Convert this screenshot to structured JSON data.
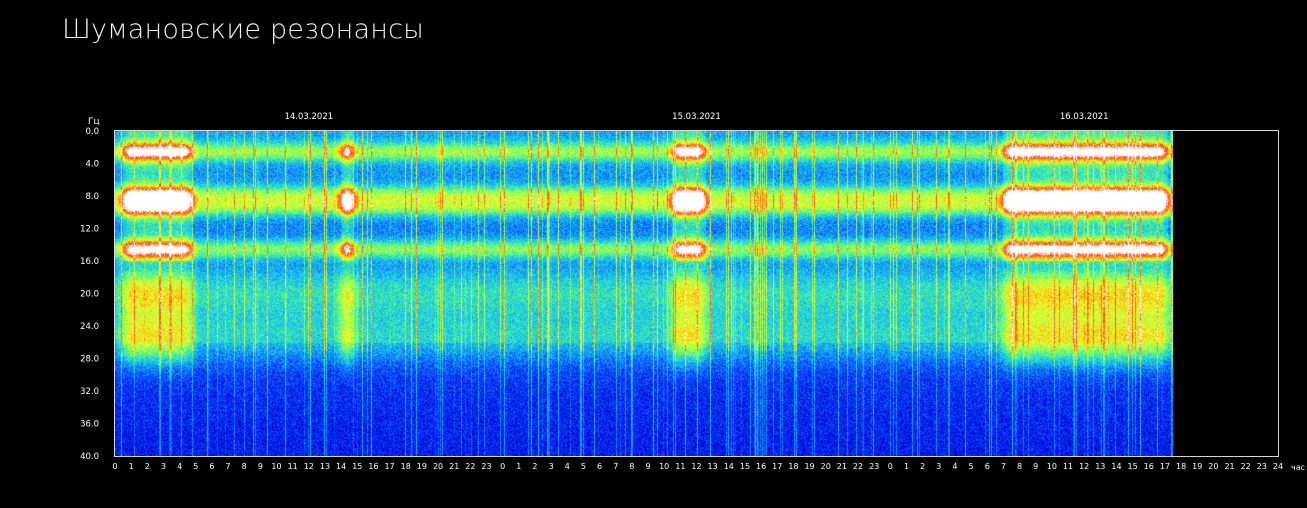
{
  "page": {
    "title": "Шумановские резонансы"
  },
  "chart_data": {
    "type": "heatmap",
    "ylabel": "Гц",
    "xlabel": "час",
    "ylim": [
      0,
      40
    ],
    "y_ticks": [
      "0.0",
      "4.0",
      "8.0",
      "12.0",
      "16.0",
      "20.0",
      "24.0",
      "28.0",
      "32.0",
      "36.0",
      "40.0"
    ],
    "x_ticks": [
      "0",
      "1",
      "2",
      "3",
      "4",
      "5",
      "6",
      "7",
      "8",
      "9",
      "10",
      "11",
      "12",
      "13",
      "14",
      "15",
      "16",
      "17",
      "18",
      "19",
      "20",
      "21",
      "22",
      "23",
      "0",
      "1",
      "2",
      "3",
      "4",
      "5",
      "6",
      "7",
      "8",
      "9",
      "10",
      "11",
      "12",
      "13",
      "14",
      "15",
      "16",
      "17",
      "18",
      "19",
      "20",
      "21",
      "22",
      "23",
      "0",
      "1",
      "2",
      "3",
      "4",
      "5",
      "6",
      "7",
      "8",
      "9",
      "10",
      "11",
      "12",
      "13",
      "14",
      "15",
      "16",
      "17",
      "18",
      "19",
      "20",
      "21",
      "22",
      "23",
      "24"
    ],
    "date_labels": [
      {
        "label": "14.03.2021",
        "hour": 12
      },
      {
        "label": "15.03.2021",
        "hour": 36
      },
      {
        "label": "16.03.2021",
        "hour": 60
      }
    ],
    "x_range_hours": [
      0,
      72
    ],
    "data_end_hour": 65.6,
    "resonance_bands_hz": [
      2.5,
      7.8,
      9.3,
      14.5,
      20.0,
      25.5
    ],
    "high_activity_periods_hours": [
      [
        0,
        5.2
      ],
      [
        13.5,
        15.2
      ],
      [
        34,
        37
      ],
      [
        54.5,
        65.6
      ]
    ],
    "colormap": [
      "#000066",
      "#0000cc",
      "#0a3cff",
      "#12a0ff",
      "#2ae6c8",
      "#8cff50",
      "#f0ff30",
      "#ffa000",
      "#ff3c14",
      "#ffffff"
    ],
    "grid": false
  }
}
